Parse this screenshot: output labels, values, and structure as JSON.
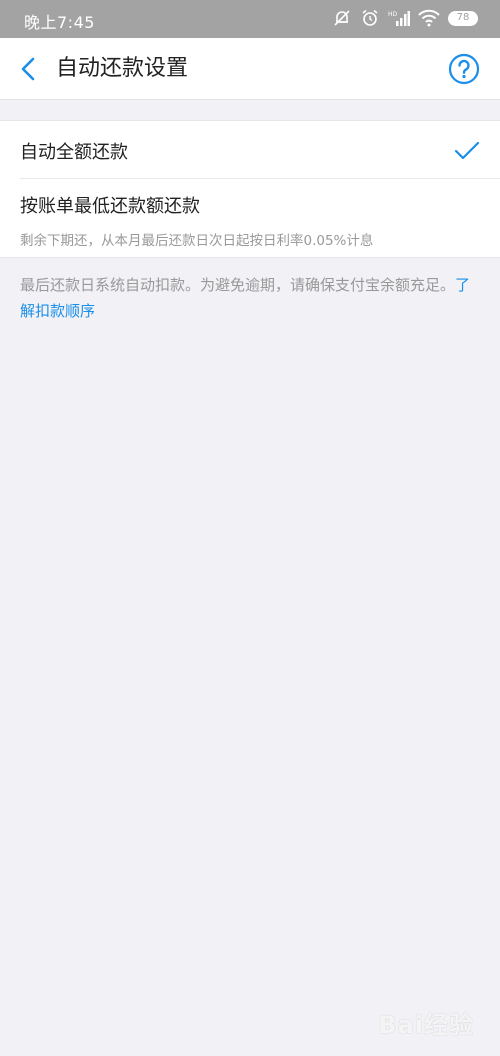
{
  "status_bar": {
    "time": "晚上7:45",
    "battery": "78",
    "icons": [
      "mute-icon",
      "alarm-icon",
      "signal-icon",
      "wifi-icon",
      "battery-icon"
    ]
  },
  "nav": {
    "title": "自动还款设置",
    "back_icon": "chevron-left-icon",
    "help_icon": "help-circle-icon"
  },
  "options": [
    {
      "label": "自动全额还款",
      "selected": true
    },
    {
      "label": "按账单最低还款额还款",
      "subtext": "剩余下期还，从本月最后还款日次日起按日利率0.05%计息",
      "selected": false
    }
  ],
  "footnote": {
    "text": "最后还款日系统自动扣款。为避免逾期，请确保支付宝余额充足。",
    "link": "了解扣款顺序"
  },
  "watermark": {
    "text": "Bai经验"
  },
  "colors": {
    "accent": "#1a8ee8",
    "background": "#f1f1f6",
    "status_bar": "#a3a3a3"
  }
}
